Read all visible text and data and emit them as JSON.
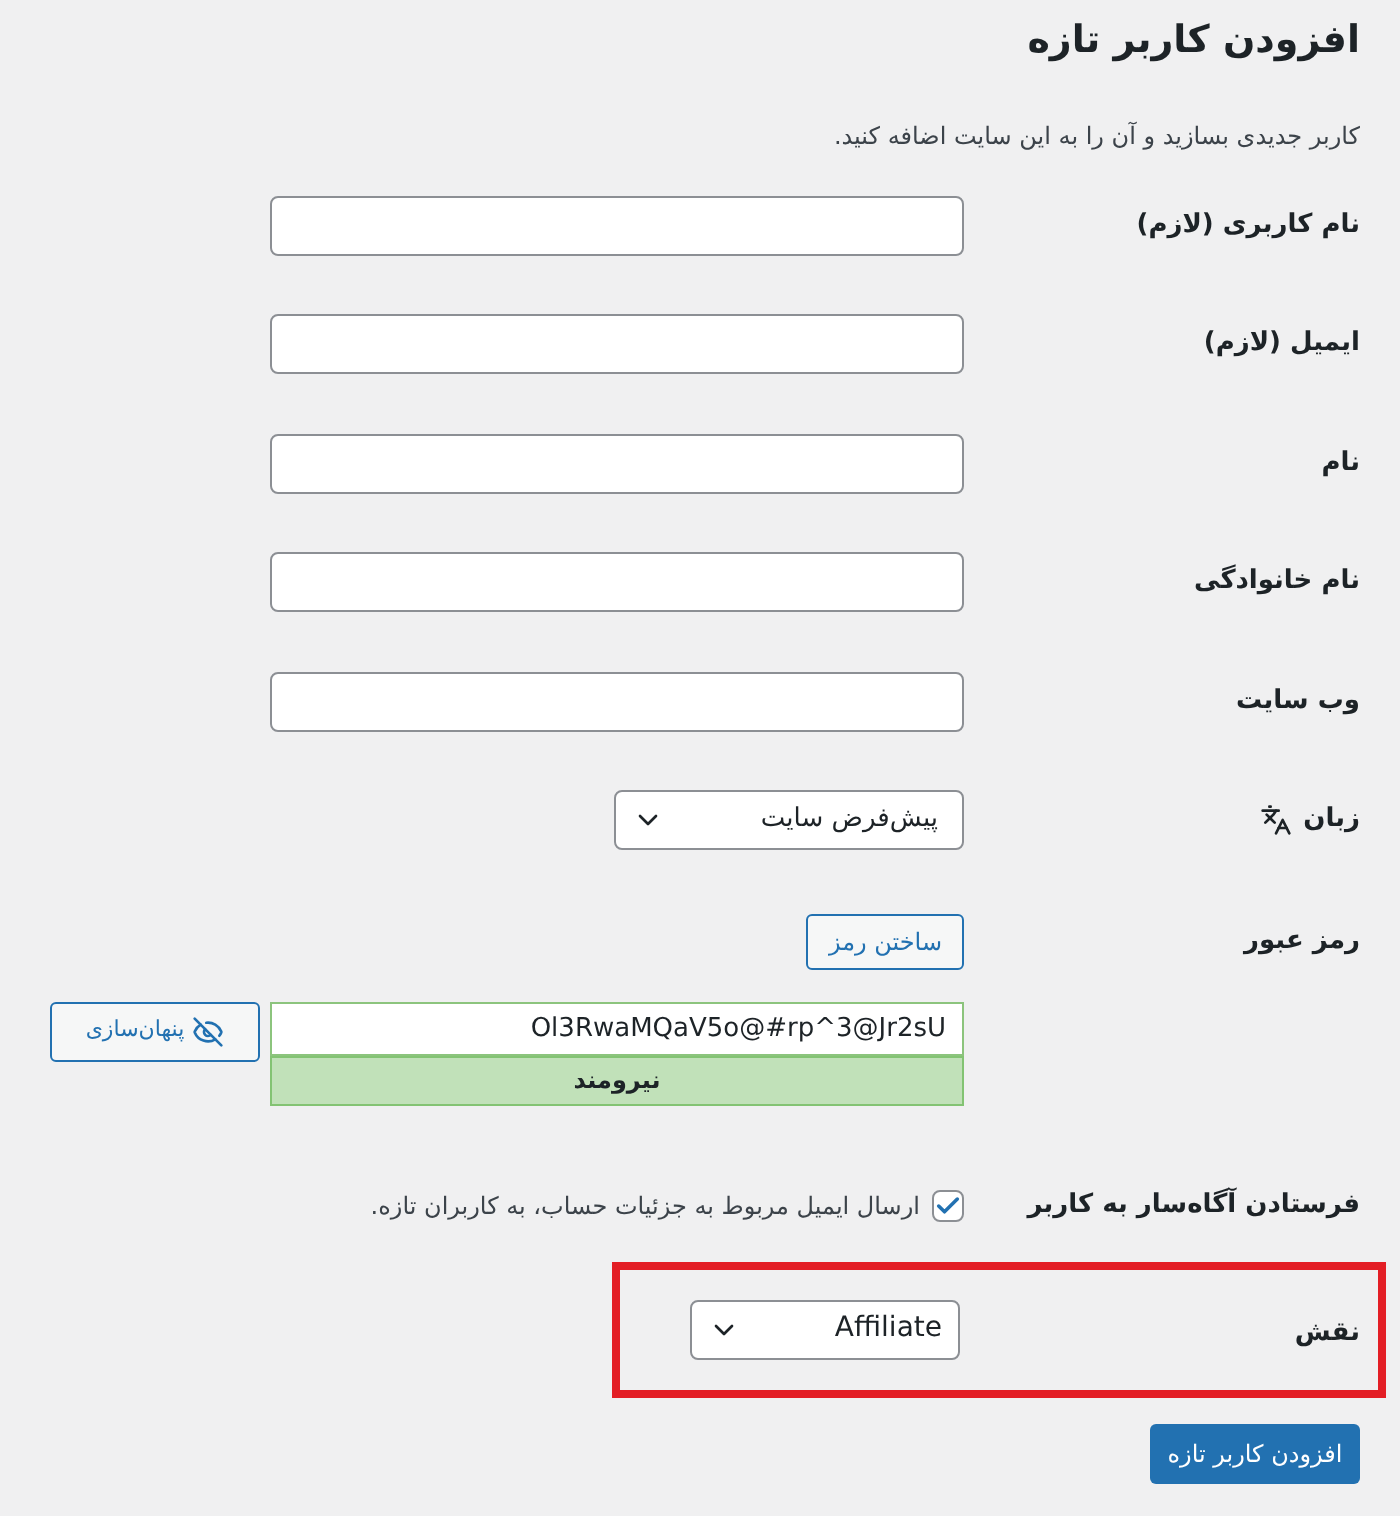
{
  "title": "افزودن کاربر تازه",
  "description": "کاربر جدیدی بسازید و آن را به این سایت اضافه کنید.",
  "fields": [
    {
      "label": "نام کاربری (لازم)"
    },
    {
      "label": "ایمیل (لازم)"
    },
    {
      "label": "نام"
    },
    {
      "label": "نام خانوادگی"
    },
    {
      "label": "وب سایت"
    }
  ],
  "language": {
    "label": "زبان",
    "value": "پیش‌فرض سایت"
  },
  "password": {
    "label": "رمز عبور",
    "generate_button": "ساختن رمز",
    "value": "Ol3RwaMQaV5o@#rp^3@Jr2sU",
    "strength": {
      "text": "نیرومند",
      "kind": "strong"
    },
    "hide_button": "پنهان‌سازی"
  },
  "notify": {
    "label": "فرستادن آگاه‌سار به کاربر",
    "checked": true,
    "text": "ارسال ایمیل مربوط به جزئیات حساب، به کاربران تازه."
  },
  "role": {
    "label": "نقش",
    "value": "Affiliate",
    "highlighted": true
  },
  "submit": "افزودن کاربر تازه"
}
